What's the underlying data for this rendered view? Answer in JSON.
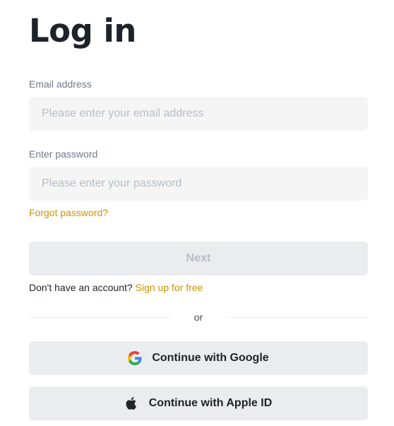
{
  "title": "Log in",
  "email": {
    "label": "Email address",
    "placeholder": "Please enter your email address",
    "value": ""
  },
  "password": {
    "label": "Enter password",
    "placeholder": "Please enter your password",
    "value": ""
  },
  "forgot_password": "Forgot password?",
  "next_label": "Next",
  "signup": {
    "prompt": "Don't have an account?",
    "link": "Sign up for free"
  },
  "divider_text": "or",
  "social": {
    "google": {
      "label": "Continue with Google",
      "icon": "google-icon"
    },
    "apple": {
      "label": "Continue with Apple ID",
      "icon": "apple-icon"
    }
  },
  "colors": {
    "accent": "#c99400",
    "text": "#1e2329",
    "label": "#707a8a",
    "input_bg": "#f5f5f5",
    "button_bg": "#eaecef",
    "disabled_text": "#b7bdc6"
  }
}
